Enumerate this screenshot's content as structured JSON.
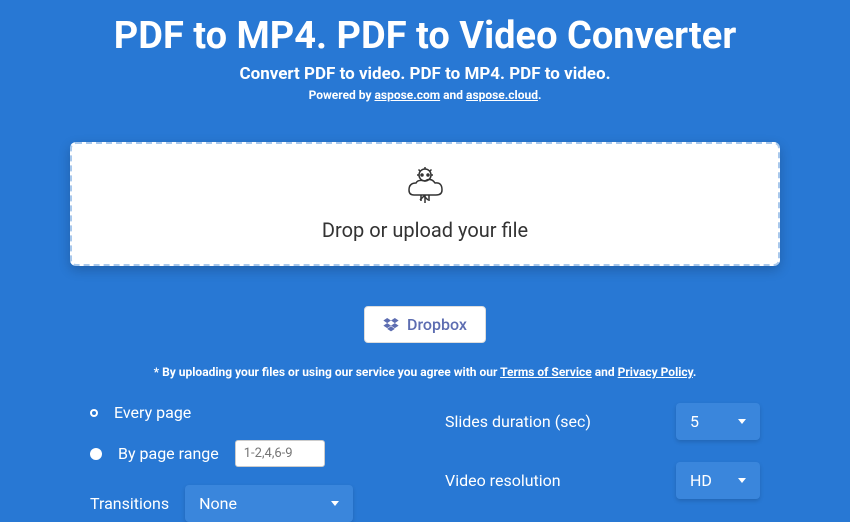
{
  "header": {
    "title": "PDF to MP4. PDF to Video Converter",
    "subtitle": "Convert PDF to video. PDF to MP4. PDF to video.",
    "powered_prefix": "Powered by ",
    "link1": "aspose.com",
    "and": " and ",
    "link2": "aspose.cloud",
    "period": "."
  },
  "dropzone": {
    "text": "Drop or upload your file"
  },
  "dropbox": {
    "label": "Dropbox"
  },
  "terms": {
    "prefix": "* By uploading your files or using our service you agree with our ",
    "tos": "Terms of Service",
    "and": " and ",
    "privacy": "Privacy Policy",
    "period": "."
  },
  "options": {
    "every_page": "Every page",
    "by_page_range": "By page range",
    "page_range_placeholder": "1-2,4,6-9",
    "slides_duration_label": "Slides duration (sec)",
    "slides_duration_value": "5",
    "resolution_label": "Video resolution",
    "resolution_value": "HD",
    "transitions_label": "Transitions",
    "transitions_value": "None"
  }
}
